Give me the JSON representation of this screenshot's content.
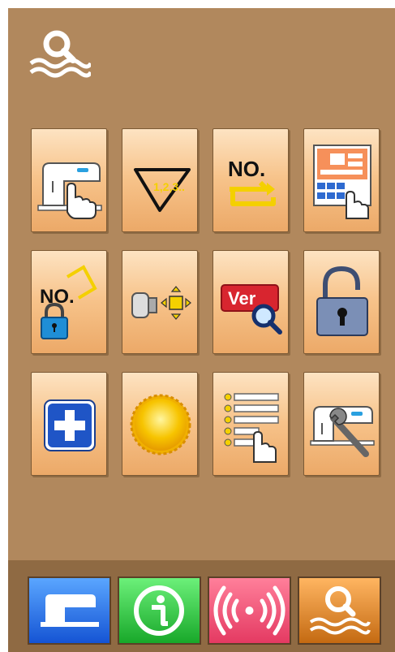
{
  "header": {
    "icon": "search-waves-icon"
  },
  "tiles": [
    {
      "name": "sewing-machine-touch",
      "icon": "sewing-machine-touch-icon"
    },
    {
      "name": "sequence-numbering",
      "icon": "triangle-123-icon",
      "text": "1,2,3.."
    },
    {
      "name": "pattern-number-cycle",
      "icon": "no-cycle-icon",
      "text": "NO."
    },
    {
      "name": "pattern-grid-edit",
      "icon": "grid-touch-icon"
    },
    {
      "name": "pattern-number-lock",
      "icon": "no-lock-icon",
      "text": "NO."
    },
    {
      "name": "usb-transfer",
      "icon": "usb-transfer-icon"
    },
    {
      "name": "version-info",
      "icon": "ver-search-icon",
      "text": "Ver"
    },
    {
      "name": "unlock",
      "icon": "padlock-open-icon"
    },
    {
      "name": "add",
      "icon": "plus-icon"
    },
    {
      "name": "brightness",
      "icon": "sun-icon"
    },
    {
      "name": "list-settings",
      "icon": "list-touch-icon"
    },
    {
      "name": "machine-maintenance",
      "icon": "machine-wrench-icon"
    }
  ],
  "bottom_bar": [
    {
      "name": "sewing-mode",
      "icon": "sewing-machine-icon",
      "color": "#1f6ee6"
    },
    {
      "name": "info",
      "icon": "info-icon",
      "color": "#22b636"
    },
    {
      "name": "signal",
      "icon": "signal-icon",
      "color": "#e9456c"
    },
    {
      "name": "search",
      "icon": "search-waves-icon",
      "color": "#d17a1e"
    }
  ]
}
